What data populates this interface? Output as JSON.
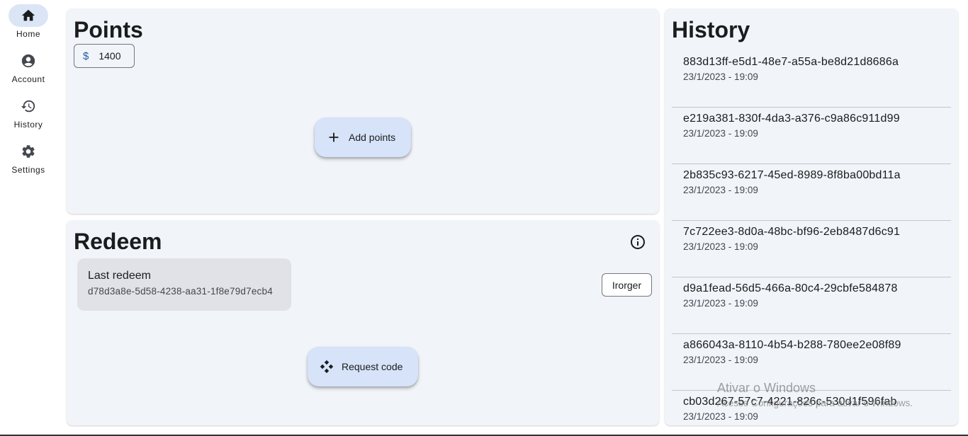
{
  "nav": {
    "items": [
      {
        "label": "Home",
        "icon": "home-icon",
        "active": true
      },
      {
        "label": "Account",
        "icon": "account-circle-icon",
        "active": false
      },
      {
        "label": "History",
        "icon": "history-icon",
        "active": false
      },
      {
        "label": "Settings",
        "icon": "gear-icon",
        "active": false
      }
    ]
  },
  "points": {
    "title": "Points",
    "currency_symbol": "$",
    "balance": "1400",
    "add_button_label": "Add points"
  },
  "redeem": {
    "title": "Redeem",
    "last_redeem_title": "Last redeem",
    "last_redeem_code": "d78d3a8e-5d58-4238-aa31-1f8e79d7ecb4",
    "side_button_label": "Irorger",
    "request_button_label": "Request code"
  },
  "history": {
    "title": "History",
    "items": [
      {
        "id": "883d13ff-e5d1-48e7-a55a-be8d21d8686a",
        "date": "23/1/2023 - 19:09"
      },
      {
        "id": "e219a381-830f-4da3-a376-c9a86c911d99",
        "date": "23/1/2023 - 19:09"
      },
      {
        "id": "2b835c93-6217-45ed-8989-8f8ba00bd11a",
        "date": "23/1/2023 - 19:09"
      },
      {
        "id": "7c722ee3-8d0a-48bc-bf96-2eb8487d6c91",
        "date": "23/1/2023 - 19:09"
      },
      {
        "id": "d9a1fead-56d5-466a-80c4-29cbfe584878",
        "date": "23/1/2023 - 19:09"
      },
      {
        "id": "a866043a-8110-4b54-b288-780ee2e08f89",
        "date": "23/1/2023 - 19:09"
      },
      {
        "id": "cb03d267-57c7-4221-826c-530d1f596fab",
        "date": "23/1/2023 - 19:09"
      }
    ]
  },
  "watermark": {
    "line1": "Ativar o Windows",
    "line2": "Acesse Configurações para ativar o Windows."
  },
  "colors": {
    "card_bg": "#f1f4f9",
    "fab_bg": "#d6e3f8",
    "active_pill": "#dbe5f5",
    "accent": "#1c5f9e"
  }
}
